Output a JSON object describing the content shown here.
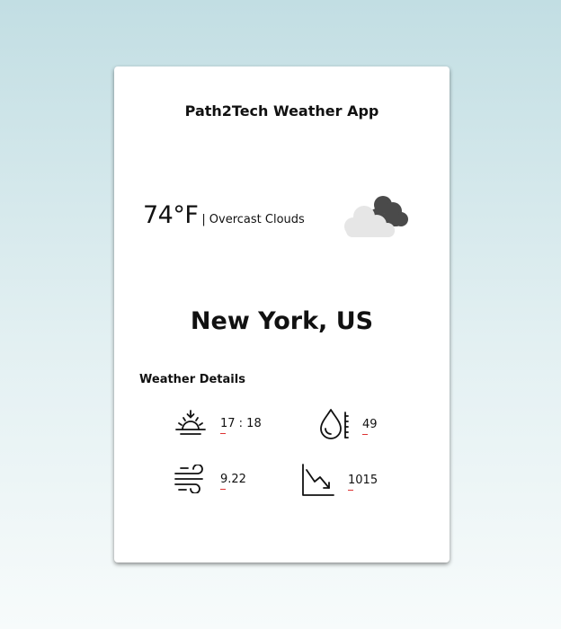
{
  "app": {
    "title": "Path2Tech Weather App"
  },
  "current": {
    "temperature": "74°F",
    "separator": "|",
    "description": "Overcast Clouds",
    "icon": "overcast-cloud-icon"
  },
  "location": {
    "city": "New York, US"
  },
  "details": {
    "title": "Weather Details",
    "sunset": {
      "icon": "sunset-icon",
      "value": "17 : 18"
    },
    "humidity": {
      "icon": "humidity-icon",
      "value": "49"
    },
    "wind": {
      "icon": "wind-icon",
      "value": "9.22"
    },
    "pressure": {
      "icon": "pressure-trend-icon",
      "value": "1015"
    }
  },
  "colors": {
    "background_top": "#c2dee3",
    "background_bottom": "#f7fbfb",
    "card": "#ffffff",
    "cloud_dark": "#4a4a4a",
    "cloud_light": "#e6e6e6"
  }
}
